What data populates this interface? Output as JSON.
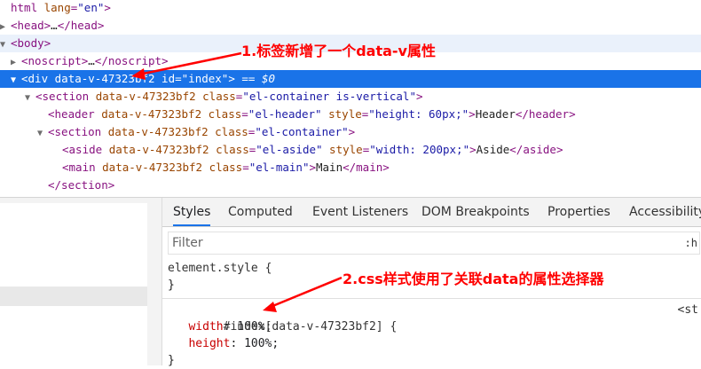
{
  "dom_tree": {
    "rows": [
      {
        "tri": "",
        "indent": 0,
        "tokens": [
          {
            "c": "tag",
            "t": "html"
          },
          {
            "c": "an",
            "t": " lang"
          },
          {
            "c": "tag",
            "t": "="
          },
          {
            "c": "av",
            "t": "\"en\""
          },
          {
            "c": "tag",
            "t": ">"
          }
        ]
      },
      {
        "tri": "▶",
        "indent": 0,
        "tokens": [
          {
            "c": "tag",
            "t": "<head>"
          },
          {
            "c": "txt",
            "t": "…"
          },
          {
            "c": "tag",
            "t": "</head>"
          }
        ]
      },
      {
        "tri": "▼",
        "indent": 0,
        "hover": true,
        "tokens": [
          {
            "c": "tag",
            "t": "<body>"
          }
        ]
      },
      {
        "tri": "▶",
        "indent": 1,
        "tokens": [
          {
            "c": "tag",
            "t": "<noscript>"
          },
          {
            "c": "txt",
            "t": "…"
          },
          {
            "c": "tag",
            "t": "</noscript>"
          }
        ]
      },
      {
        "tri": "▼",
        "indent": 1,
        "selected": true,
        "tokens": [
          {
            "c": "tag",
            "t": "<div "
          },
          {
            "c": "an",
            "t": "data-v-47323bf2 id"
          },
          {
            "c": "tag",
            "t": "="
          },
          {
            "c": "av",
            "t": "\"index\""
          },
          {
            "c": "tag",
            "t": ">"
          },
          {
            "c": "eq",
            "t": " == $0"
          }
        ]
      },
      {
        "tri": "▼",
        "indent": 2,
        "tokens": [
          {
            "c": "tag",
            "t": "<section "
          },
          {
            "c": "an",
            "t": "data-v-47323bf2 class"
          },
          {
            "c": "tag",
            "t": "="
          },
          {
            "c": "av",
            "t": "\"el-container is-vertical\""
          },
          {
            "c": "tag",
            "t": ">"
          }
        ]
      },
      {
        "tri": "",
        "indent": 3,
        "tokens": [
          {
            "c": "tag",
            "t": "<header "
          },
          {
            "c": "an",
            "t": "data-v-47323bf2 class"
          },
          {
            "c": "tag",
            "t": "="
          },
          {
            "c": "av",
            "t": "\"el-header\""
          },
          {
            "c": "an",
            "t": " style"
          },
          {
            "c": "tag",
            "t": "="
          },
          {
            "c": "av",
            "t": "\"height: 60px;\""
          },
          {
            "c": "tag",
            "t": ">"
          },
          {
            "c": "txt",
            "t": "Header"
          },
          {
            "c": "tag",
            "t": "</header>"
          }
        ]
      },
      {
        "tri": "▼",
        "indent": 3,
        "tokens": [
          {
            "c": "tag",
            "t": "<section "
          },
          {
            "c": "an",
            "t": "data-v-47323bf2 class"
          },
          {
            "c": "tag",
            "t": "="
          },
          {
            "c": "av",
            "t": "\"el-container\""
          },
          {
            "c": "tag",
            "t": ">"
          }
        ]
      },
      {
        "tri": "",
        "indent": 4,
        "tokens": [
          {
            "c": "tag",
            "t": "<aside "
          },
          {
            "c": "an",
            "t": "data-v-47323bf2 class"
          },
          {
            "c": "tag",
            "t": "="
          },
          {
            "c": "av",
            "t": "\"el-aside\""
          },
          {
            "c": "an",
            "t": " style"
          },
          {
            "c": "tag",
            "t": "="
          },
          {
            "c": "av",
            "t": "\"width: 200px;\""
          },
          {
            "c": "tag",
            "t": ">"
          },
          {
            "c": "txt",
            "t": "Aside"
          },
          {
            "c": "tag",
            "t": "</aside>"
          }
        ]
      },
      {
        "tri": "",
        "indent": 4,
        "tokens": [
          {
            "c": "tag",
            "t": "<main "
          },
          {
            "c": "an",
            "t": "data-v-47323bf2 class"
          },
          {
            "c": "tag",
            "t": "="
          },
          {
            "c": "av",
            "t": "\"el-main\""
          },
          {
            "c": "tag",
            "t": ">"
          },
          {
            "c": "txt",
            "t": "Main"
          },
          {
            "c": "tag",
            "t": "</main>"
          }
        ]
      },
      {
        "tri": "",
        "indent": 3,
        "tokens": [
          {
            "c": "tag",
            "t": "</section>"
          }
        ]
      }
    ]
  },
  "styles_panel": {
    "tabs": [
      {
        "label": "Styles",
        "active": true
      },
      {
        "label": "Computed"
      },
      {
        "label": "Event Listeners"
      },
      {
        "label": "DOM Breakpoints"
      },
      {
        "label": "Properties"
      },
      {
        "label": "Accessibility"
      }
    ],
    "filter_placeholder": "Filter",
    "filter_toggle": ":h",
    "element_style_open": "element.style {",
    "element_style_close": "}",
    "rule_selector": "#index[data-v-47323bf2] {",
    "rule_source": "<st",
    "declarations": [
      {
        "prop": "width",
        "value": "100%;"
      },
      {
        "prop": "height",
        "value": "100%;"
      }
    ],
    "rule_close": "}"
  },
  "annotations": {
    "note1": "1.标签新增了一个data-v属性",
    "note2": "2.css样式使用了关联data的属性选择器",
    "color": "#ff0000"
  },
  "colors": {
    "selected_row": "#1a73e8",
    "hover_row": "#eaf1fb",
    "tag": "#881280",
    "attr_name": "#994500",
    "attr_value": "#1a1aa6",
    "css_property": "#c80000"
  }
}
